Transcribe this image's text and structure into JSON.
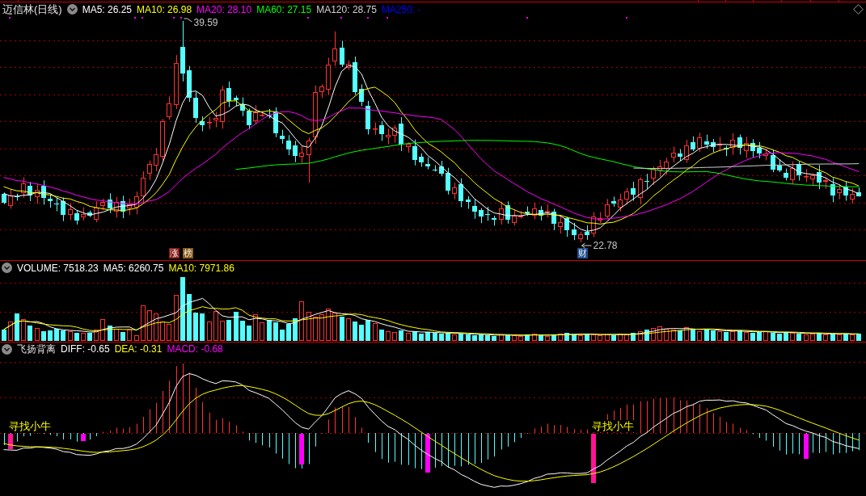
{
  "main_chart": {
    "title": "迈信林(日线)",
    "legend": [
      {
        "text": "MA5: 26.25",
        "color": "#ffffff"
      },
      {
        "text": "MA10: 26.98",
        "color": "#ffff00"
      },
      {
        "text": "MA20: 28.10",
        "color": "#ff00ff"
      },
      {
        "text": "MA60: 27.15",
        "color": "#00ff00"
      },
      {
        "text": "MA120: 28.75",
        "color": "#d0d0d0"
      },
      {
        "text": "MA250: -",
        "color": "#0000ff"
      }
    ],
    "high_label": "39.59",
    "low_label": "22.78",
    "tags": [
      {
        "text": "涨",
        "color": "#8b1a1a"
      },
      {
        "text": "榜",
        "color": "#8b5a1a"
      },
      {
        "text": "财",
        "color": "#1c4f8f"
      }
    ]
  },
  "volume_panel": {
    "legend": [
      {
        "text": "VOLUME: 7518.23",
        "color": "#ffffff"
      },
      {
        "text": "MA5: 6260.75",
        "color": "#ffffff"
      },
      {
        "text": "MA10: 7971.86",
        "color": "#ffff00"
      }
    ]
  },
  "macd_panel": {
    "title": "飞扬背离",
    "legend": [
      {
        "text": "DIFF: -0.65",
        "color": "#ffffff"
      },
      {
        "text": "DEA: -0.31",
        "color": "#ffff00"
      },
      {
        "text": "MACD: -0.68",
        "color": "#ff00ff"
      }
    ],
    "signal_labels": [
      "寻找小牛",
      "寻找小牛"
    ]
  }
}
